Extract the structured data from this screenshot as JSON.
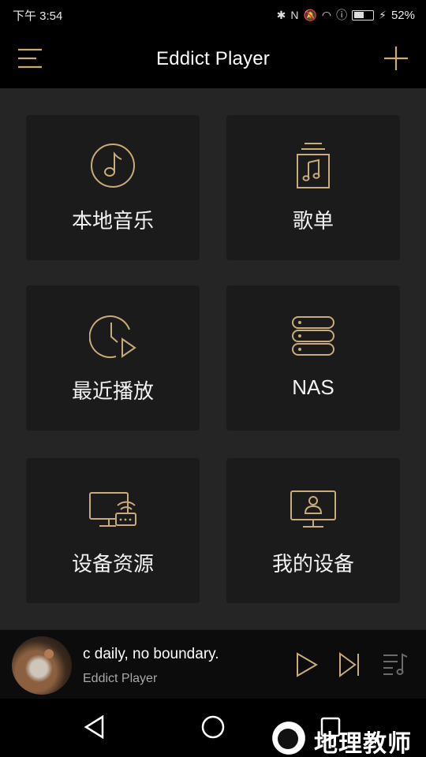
{
  "status_bar": {
    "time": "下午 3:54",
    "battery_percent": "52%",
    "battery_level": 0.52
  },
  "app_bar": {
    "title": "Eddict Player"
  },
  "tiles": [
    {
      "label": "本地音乐",
      "icon": "music-note-icon"
    },
    {
      "label": "歌单",
      "icon": "playlist-icon"
    },
    {
      "label": "最近播放",
      "icon": "recent-play-icon"
    },
    {
      "label": "NAS",
      "icon": "server-icon"
    },
    {
      "label": "设备资源",
      "icon": "device-resource-icon"
    },
    {
      "label": "我的设备",
      "icon": "my-device-icon"
    }
  ],
  "player": {
    "title": "c daily, no boundary.",
    "artist": "Eddict Player"
  },
  "watermark": {
    "text": "地理教师"
  },
  "colors": {
    "accent_gold": "#c9ab7a",
    "tile_bg": "#1b1b1b",
    "main_bg": "#252525"
  }
}
